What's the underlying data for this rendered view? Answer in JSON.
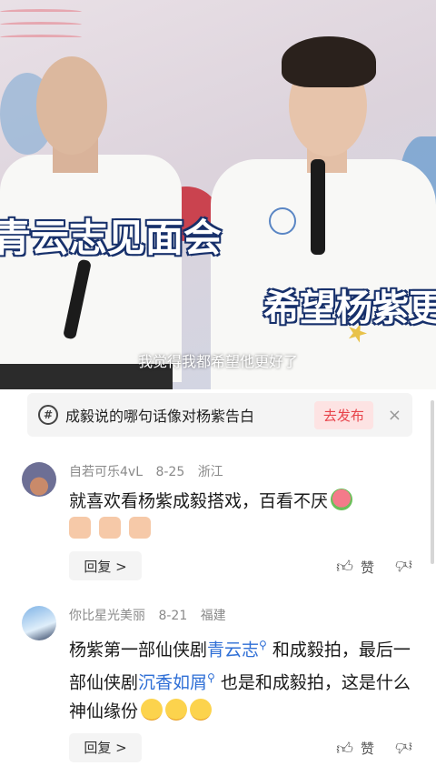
{
  "video": {
    "caption_left": "青云志见面会",
    "caption_right": "希望杨紫更",
    "subtitle": "我觉得我都希望他更好了"
  },
  "topic": {
    "text": "成毅说的哪句话像对杨紫告白",
    "publish_label": "去发布",
    "close_glyph": "×",
    "hash_glyph": "#"
  },
  "comments": [
    {
      "user": "自若可乐4vL",
      "date": "8-25",
      "location": "浙江",
      "text": "就喜欢看杨紫成毅搭戏，百看不厌",
      "reply_label": "回复 >",
      "like_label": "赞"
    },
    {
      "user": "你比星光美丽",
      "date": "8-21",
      "location": "福建",
      "text_part1": "杨紫第一部仙侠剧",
      "link1": "青云志",
      "text_part2": " 和成毅拍，最后一部仙侠剧",
      "link2": "沉香如屑",
      "text_part3": " 也是和成毅拍，这是什么神仙缘份",
      "reply_label": "回复 >",
      "like_label": "赞"
    }
  ],
  "icons": {
    "like": "thumbs-up-icon",
    "dislike": "thumbs-down-icon",
    "search_mark": "search-icon"
  },
  "colors": {
    "accent_red": "#e8434a",
    "link_blue": "#2f6fd6",
    "caption_stroke": "#17306b"
  }
}
